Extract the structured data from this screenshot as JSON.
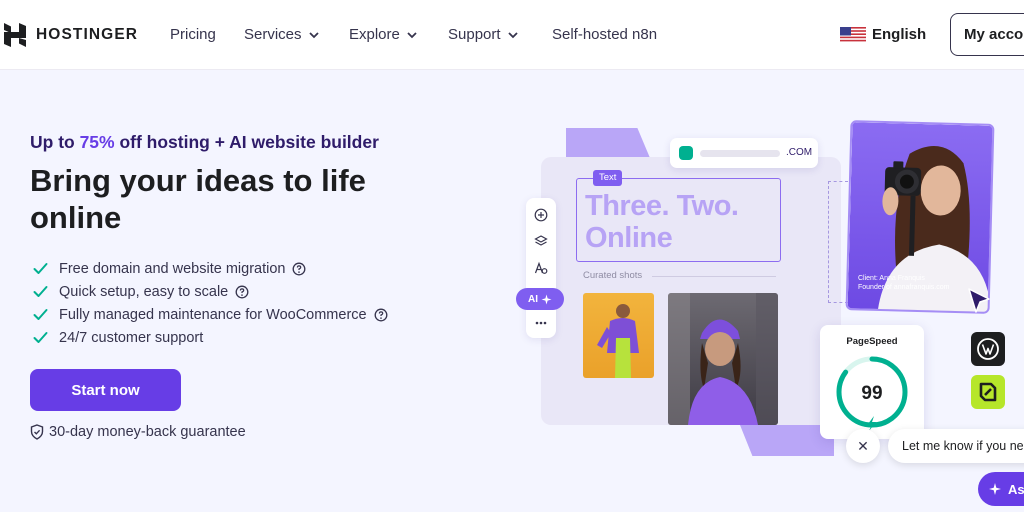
{
  "nav": {
    "brand": "HOSTINGER",
    "items": [
      {
        "label": "Pricing",
        "has_dropdown": false
      },
      {
        "label": "Services",
        "has_dropdown": true
      },
      {
        "label": "Explore",
        "has_dropdown": true
      },
      {
        "label": "Support",
        "has_dropdown": true
      },
      {
        "label": "Self-hosted n8n",
        "has_dropdown": false
      }
    ],
    "language": "English",
    "account_button": "My account"
  },
  "hero": {
    "kicker_prefix": "Up to ",
    "kicker_percent": "75%",
    "kicker_suffix": " off hosting + AI website builder",
    "headline": "Bring your ideas to life online",
    "features": [
      "Free domain and website migration",
      "Quick setup, easy to scale",
      "Fully managed maintenance for WooCommerce",
      "24/7 customer support"
    ],
    "cta": "Start now",
    "guarantee": "30-day money-back guarantee"
  },
  "builder_preview": {
    "domain_tld": ".COM",
    "text_tag": "Text",
    "text_line1": "Three. Two.",
    "text_line2": "Online",
    "curated_label": "Curated shots",
    "ai_label": "AI",
    "credit_name": "Client: Anna Franquis",
    "credit_role": "Founder of annafranquis.com",
    "pagespeed_title": "PageSpeed",
    "pagespeed_score": "99",
    "pagespeed_fraction": 0.99,
    "tiles": [
      "wordpress-icon",
      "website-builder-icon"
    ]
  },
  "chat": {
    "message": "Let me know if you need help",
    "ask_label": "Ask"
  },
  "colors": {
    "brand_purple": "#673de6",
    "accent_green": "#00b090",
    "headline_dark": "#1d1e20"
  }
}
